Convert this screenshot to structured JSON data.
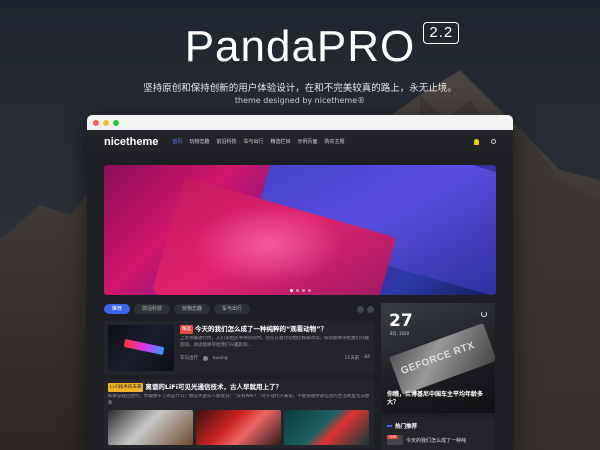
{
  "hero": {
    "title": "PandaPRO",
    "version": "2.2",
    "subtitle": "坚持原创和保持创新的用户体验设计，在和不完美较真的路上，永无止境。",
    "credit": "theme designed by nicetheme®"
  },
  "site": {
    "logo": "nicetheme",
    "nav": [
      "首页",
      "玩物志趣",
      "前沿科技",
      "车与出行",
      "精选栏目",
      "示例页面",
      "购买主题"
    ],
    "active_nav": "首页",
    "icons": {
      "bulb": "bulb-icon",
      "search": "search-icon"
    }
  },
  "filter_tabs": [
    "推荐",
    "前沿科技",
    "玩物志趣",
    "车与出行"
  ],
  "active_tab": "推荐",
  "articles": [
    {
      "tag": "精选",
      "title": "今天的我们怎么成了一种纯粹的“观看动物”？",
      "excerpt": "上周书展进行时，入们争相买书书的同时，也在在意讨论相比媒质阅读。阅读能唤带给我们兴趣影响。阅读能唤带给我们兴趣影响…",
      "category": "车与出行",
      "author": "kusing",
      "time": "11天前",
      "likes": "84"
    },
    {
      "tag": "Li-Fi技术的未来",
      "title": "离谱的LiFi可见光通信技术，古人早就用上了？",
      "excerpt": "如果穿越回古代，你最想干了的是什么？想必大部分人都会说：“没有WiFi！”对于现代人来说，不能快速传递信息的生活简直无法想象"
    }
  ],
  "promo": {
    "day": "27",
    "date": "8月, 2020",
    "card_text": "GEFORCE RTX",
    "title": "你瞧，兰博基尼中国车主平均年龄多大？"
  },
  "hot": {
    "heading": "热门推荐",
    "item_tag": "TOP",
    "item_title": "今天的我们怎么成了一种纯"
  }
}
